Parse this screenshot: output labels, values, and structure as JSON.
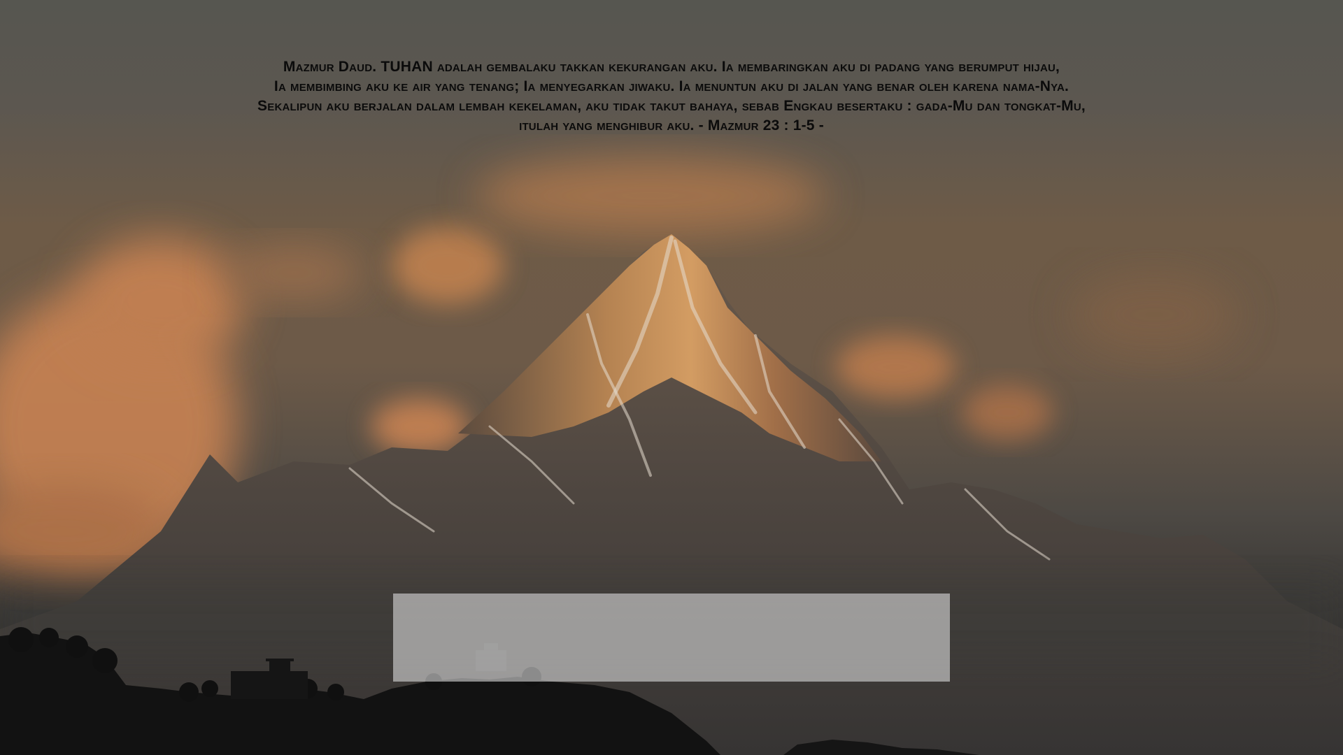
{
  "wallpaper": {
    "verse_text": "Mazmur Daud. TUHAN adalah gembalaku takkan kekurangan aku. Ia membaringkan aku di padang yang berumput hijau,\nIa membimbing aku ke air yang tenang; Ia menyegarkan jiwaku. Ia menuntun aku di jalan yang benar oleh karena nama-Nya.\nSekalipun aku berjalan dalam lembah kekelaman, aku tidak takut bahaya, sebab Engkau besertaku : gada-Mu dan tongkat-Mu,\nitulah yang menghibur aku. - Mazmur 23 : 1-5 -",
    "colors": {
      "sky_top": "#565650",
      "cloud_glow": "#c98352",
      "peak_lit": "#d89a5a",
      "mountain_shadow": "#4a3f38",
      "foreground_silhouette": "#121212",
      "verse_text": "#0b0b0b",
      "caption_panel": "#d7d7d7"
    }
  }
}
